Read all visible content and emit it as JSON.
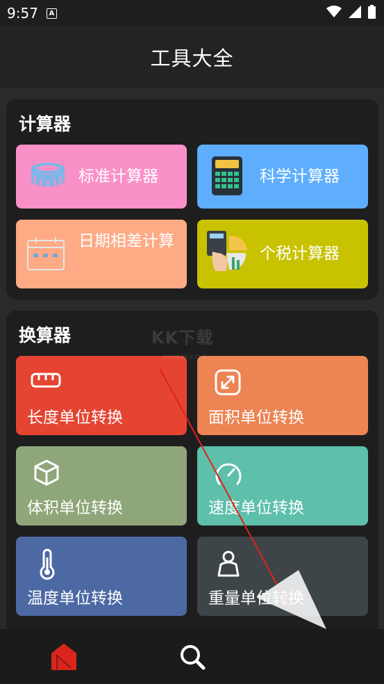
{
  "status_bar": {
    "time": "9:57",
    "notification_letter": "A"
  },
  "header": {
    "title": "工具大全"
  },
  "sections": {
    "calculators": {
      "title": "计算器",
      "items": [
        {
          "label": "标准计算器",
          "icon": "coin-stack-icon",
          "color": "#fa90c8"
        },
        {
          "label": "科学计算器",
          "icon": "calculator-icon",
          "color": "#5eaefd"
        },
        {
          "label": "日期相差计算",
          "icon": "calendar-icon",
          "color": "#fdaa85"
        },
        {
          "label": "个税计算器",
          "icon": "tax-chart-icon",
          "color": "#c8c200"
        }
      ]
    },
    "converters": {
      "title": "换算器",
      "items": [
        {
          "label": "长度单位转换",
          "icon": "ruler-icon",
          "color": "#e54432"
        },
        {
          "label": "面积单位转换",
          "icon": "expand-icon",
          "color": "#ec8453"
        },
        {
          "label": "体积单位转换",
          "icon": "cube-icon",
          "color": "#8fa67a"
        },
        {
          "label": "速度单位转换",
          "icon": "speedometer-icon",
          "color": "#5ebfaa"
        },
        {
          "label": "温度单位转换",
          "icon": "thermometer-icon",
          "color": "#4c69a4"
        },
        {
          "label": "重量单位转换",
          "icon": "weight-icon",
          "color": "#3e4549"
        }
      ]
    }
  },
  "watermark": {
    "text": "KK下载",
    "sub": "www.kkx.net"
  },
  "bottom_nav": {
    "home_icon": "home-icon",
    "search_icon": "search-icon",
    "active_color": "#d8261d"
  }
}
